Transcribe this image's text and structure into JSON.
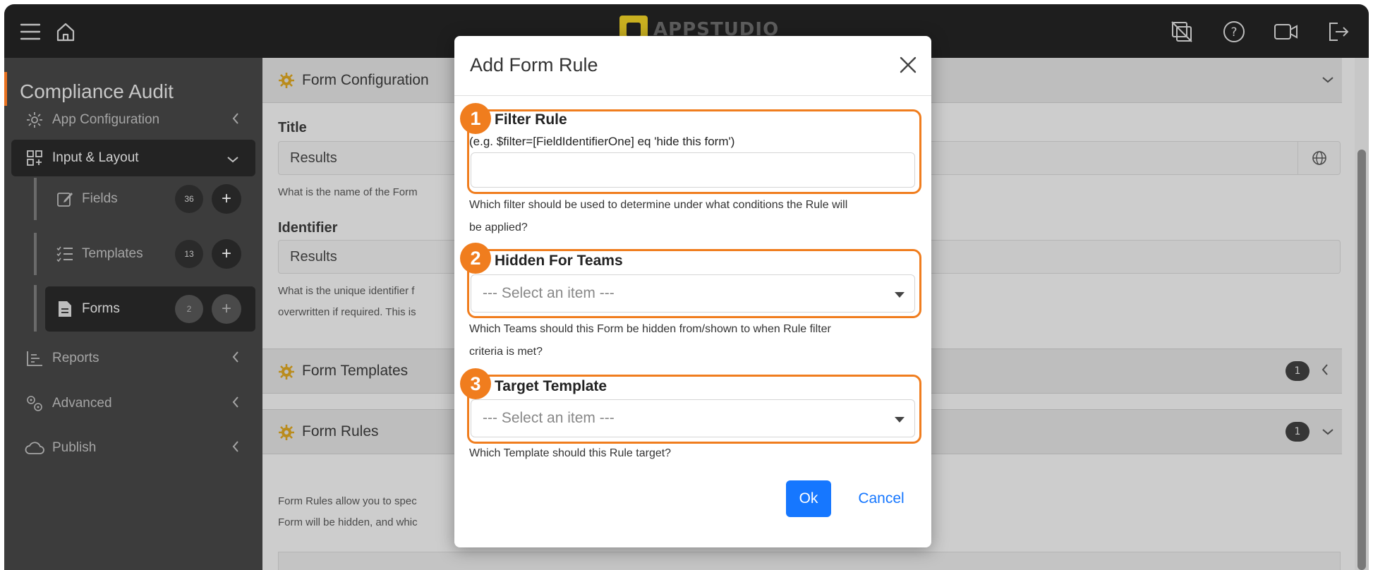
{
  "topbar": {
    "logo_text": "APPSTUDIO",
    "icons": [
      "menu-icon",
      "home-icon",
      "no-screen-icon",
      "help-icon",
      "video-icon",
      "logout-icon"
    ]
  },
  "sidebar": {
    "app_title": "Compliance Audit",
    "items": [
      {
        "label": "App Configuration",
        "icon": "gear-icon"
      },
      {
        "label": "Input & Layout",
        "icon": "grid-icon"
      },
      {
        "label": "Reports",
        "icon": "report-icon"
      },
      {
        "label": "Advanced",
        "icon": "gears-icon"
      },
      {
        "label": "Publish",
        "icon": "cloud-icon"
      }
    ],
    "sub_items": [
      {
        "label": "Fields",
        "count": "36",
        "add": "+"
      },
      {
        "label": "Templates",
        "count": "13",
        "add": "+"
      },
      {
        "label": "Forms",
        "count": "2",
        "add": "+"
      }
    ]
  },
  "main": {
    "form_config": {
      "title": "Form Configuration",
      "title_label": "Title",
      "title_value": "Results",
      "title_help": "What is the name of the Form",
      "identifier_label": "Identifier",
      "identifier_value": "Results",
      "identifier_help_1": "What is the unique identifier f",
      "identifier_help_2": "overwritten if required. This is"
    },
    "form_templates": {
      "title": "Form Templates",
      "count": "1"
    },
    "form_rules": {
      "title": "Form Rules",
      "count": "1",
      "desc_1": "Form Rules allow you to spec",
      "desc_2": "Form will be hidden, and whic"
    }
  },
  "modal": {
    "title": "Add Form Rule",
    "filter_rule": {
      "number": "1",
      "label": "Filter Rule",
      "example": "(e.g. $filter=[FieldIdentifierOne] eq 'hide this form')",
      "value": "",
      "help_1": "Which filter should be used to determine under what conditions the Rule will",
      "help_2": "be applied?"
    },
    "hidden_for_teams": {
      "number": "2",
      "label": "Hidden For Teams",
      "placeholder": "--- Select an item ---",
      "help_1": "Which Teams should this Form be hidden from/shown to when Rule filter",
      "help_2": "criteria is met?"
    },
    "target_template": {
      "number": "3",
      "label": "Target Template",
      "placeholder": "--- Select an item ---",
      "help": "Which Template should this Rule target?"
    },
    "ok_label": "Ok",
    "cancel_label": "Cancel"
  },
  "colors": {
    "accent_orange": "#f07d1e",
    "primary_blue": "#1677ff",
    "topbar_bg": "#1e1e1e",
    "sidebar_bg": "#3c3c3c"
  }
}
